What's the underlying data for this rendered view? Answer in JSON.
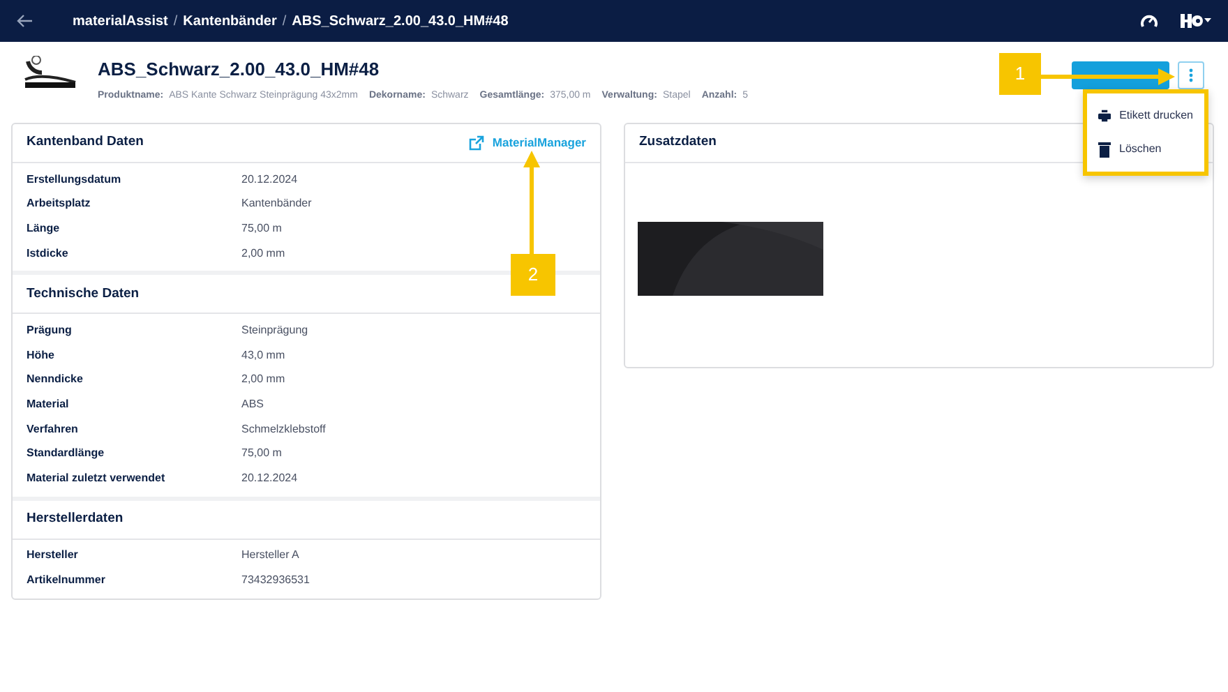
{
  "navbar": {
    "breadcrumb": [
      "materialAssist",
      "Kantenbänder",
      "ABS_Schwarz_2.00_43.0_HM#48"
    ],
    "separator": "/"
  },
  "header": {
    "title": "ABS_Schwarz_2.00_43.0_HM#48",
    "meta": [
      {
        "label": "Produktname:",
        "value": "ABS Kante Schwarz Steinprägung 43x2mm"
      },
      {
        "label": "Dekorname:",
        "value": "Schwarz"
      },
      {
        "label": "Gesamtlänge:",
        "value": "375,00 m"
      },
      {
        "label": "Verwaltung:",
        "value": "Stapel"
      },
      {
        "label": "Anzahl:",
        "value": "5"
      }
    ]
  },
  "menu": {
    "expanded": true,
    "items": [
      {
        "kind": "print",
        "label": "Etikett drucken"
      },
      {
        "kind": "delete",
        "label": "Löschen"
      }
    ]
  },
  "details": {
    "link": "MaterialManager",
    "sections": [
      {
        "title": "Kantenband Daten",
        "rows": [
          {
            "label": "Erstellungsdatum",
            "value": "20.12.2024"
          },
          {
            "label": "Arbeitsplatz",
            "value": "Kantenbänder"
          },
          {
            "label": "Länge",
            "value": "75,00 m"
          },
          {
            "label": "Istdicke",
            "value": "2,00 mm"
          }
        ]
      },
      {
        "title": "Technische Daten",
        "rows": [
          {
            "label": "Prägung",
            "value": "Steinprägung"
          },
          {
            "label": "Höhe",
            "value": "43,0 mm"
          },
          {
            "label": "Nenndicke",
            "value": "2,00 mm"
          },
          {
            "label": "Material",
            "value": "ABS"
          },
          {
            "label": "Verfahren",
            "value": "Schmelzklebstoff"
          },
          {
            "label": "Standardlänge",
            "value": "75,00 m"
          },
          {
            "label": "Material zuletzt verwendet",
            "value": "20.12.2024"
          }
        ]
      },
      {
        "title": "Herstellerdaten",
        "rows": [
          {
            "label": "Hersteller",
            "value": "Hersteller A"
          },
          {
            "label": "Artikelnummer",
            "value": "73432936531"
          }
        ]
      }
    ]
  },
  "extra": {
    "title": "Zusatzdaten"
  },
  "callouts": [
    {
      "label": "1",
      "kind": "right"
    },
    {
      "label": "2",
      "kind": "up"
    }
  ]
}
